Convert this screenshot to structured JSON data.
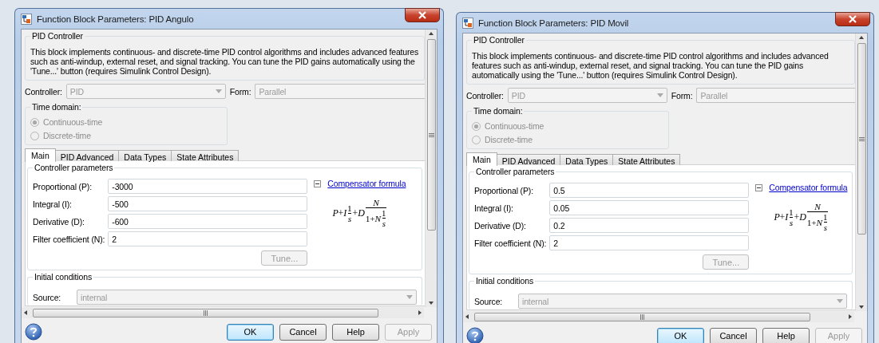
{
  "dialogs": [
    {
      "title": "Function Block Parameters: PID Angulo",
      "group_title": "PID Controller",
      "description": "This block implements continuous- and discrete-time PID control algorithms and includes advanced features such as anti-windup, external reset, and signal tracking. You can tune the PID gains automatically using the 'Tune...' button (requires Simulink Control Design).",
      "controller": {
        "label": "Controller:",
        "value": "PID",
        "disabled": true
      },
      "form": {
        "label": "Form:",
        "value": "Parallel",
        "disabled": true
      },
      "time_domain": {
        "title": "Time domain:",
        "options": [
          {
            "label": "Continuous-time",
            "selected": true,
            "disabled": true
          },
          {
            "label": "Discrete-time",
            "selected": false,
            "disabled": true
          }
        ]
      },
      "tabs": [
        {
          "label": "Main",
          "selected": true
        },
        {
          "label": "PID Advanced",
          "selected": false
        },
        {
          "label": "Data Types",
          "selected": false
        },
        {
          "label": "State Attributes",
          "selected": false
        }
      ],
      "parameters": {
        "title": "Controller parameters",
        "fields": [
          {
            "label": "Proportional (P):",
            "value": "-3000"
          },
          {
            "label": "Integral (I):",
            "value": "-500"
          },
          {
            "label": "Derivative (D):",
            "value": "-600"
          },
          {
            "label": "Filter coefficient (N):",
            "value": "2"
          }
        ],
        "link": "Compensator formula",
        "expanded": true,
        "formula": [
          {
            "kind": "var",
            "text": "P"
          },
          {
            "kind": "op",
            "text": "+"
          },
          {
            "kind": "var",
            "text": "I"
          },
          {
            "kind": "fraction",
            "num": [
              {
                "kind": "op",
                "text": "1"
              }
            ],
            "den": [
              {
                "kind": "var",
                "text": "s"
              }
            ]
          },
          {
            "kind": "op",
            "text": "+"
          },
          {
            "kind": "var",
            "text": "D"
          },
          {
            "kind": "fraction",
            "num": [
              {
                "kind": "var",
                "text": "N"
              }
            ],
            "den": [
              {
                "kind": "op",
                "text": "1+"
              },
              {
                "kind": "var",
                "text": "N"
              },
              {
                "kind": "fraction",
                "num": [
                  {
                    "kind": "op",
                    "text": "1"
                  }
                ],
                "den": [
                  {
                    "kind": "var",
                    "text": "s"
                  }
                ]
              }
            ]
          }
        ],
        "tune": {
          "label": "Tune...",
          "disabled": true
        }
      },
      "initial_conditions": {
        "title": "Initial conditions",
        "source": {
          "label": "Source:",
          "value": "internal",
          "disabled": true
        }
      },
      "buttons": [
        {
          "label": "OK",
          "default": true,
          "disabled": false
        },
        {
          "label": "Cancel",
          "default": false,
          "disabled": false
        },
        {
          "label": "Help",
          "default": false,
          "disabled": false
        },
        {
          "label": "Apply",
          "default": false,
          "disabled": true
        }
      ]
    },
    {
      "title": "Function Block Parameters: PID Movil",
      "group_title": "PID Controller",
      "description": "This block implements continuous- and discrete-time PID control algorithms and includes advanced features such as anti-windup, external reset, and signal tracking. You can tune the PID gains automatically using the 'Tune...' button (requires Simulink Control Design).",
      "controller": {
        "label": "Controller:",
        "value": "PID",
        "disabled": true
      },
      "form": {
        "label": "Form:",
        "value": "Parallel",
        "disabled": true
      },
      "time_domain": {
        "title": "Time domain:",
        "options": [
          {
            "label": "Continuous-time",
            "selected": true,
            "disabled": true
          },
          {
            "label": "Discrete-time",
            "selected": false,
            "disabled": true
          }
        ]
      },
      "tabs": [
        {
          "label": "Main",
          "selected": true
        },
        {
          "label": "PID Advanced",
          "selected": false
        },
        {
          "label": "Data Types",
          "selected": false
        },
        {
          "label": "State Attributes",
          "selected": false
        }
      ],
      "parameters": {
        "title": "Controller parameters",
        "fields": [
          {
            "label": "Proportional (P):",
            "value": "0.5"
          },
          {
            "label": "Integral (I):",
            "value": "0.05"
          },
          {
            "label": "Derivative (D):",
            "value": "0.2"
          },
          {
            "label": "Filter coefficient (N):",
            "value": "2"
          }
        ],
        "link": "Compensator formula",
        "expanded": true,
        "formula": [
          {
            "kind": "var",
            "text": "P"
          },
          {
            "kind": "op",
            "text": "+"
          },
          {
            "kind": "var",
            "text": "I"
          },
          {
            "kind": "fraction",
            "num": [
              {
                "kind": "op",
                "text": "1"
              }
            ],
            "den": [
              {
                "kind": "var",
                "text": "s"
              }
            ]
          },
          {
            "kind": "op",
            "text": "+"
          },
          {
            "kind": "var",
            "text": "D"
          },
          {
            "kind": "fraction",
            "num": [
              {
                "kind": "var",
                "text": "N"
              }
            ],
            "den": [
              {
                "kind": "op",
                "text": "1+"
              },
              {
                "kind": "var",
                "text": "N"
              },
              {
                "kind": "fraction",
                "num": [
                  {
                    "kind": "op",
                    "text": "1"
                  }
                ],
                "den": [
                  {
                    "kind": "var",
                    "text": "s"
                  }
                ]
              }
            ]
          }
        ],
        "tune": {
          "label": "Tune...",
          "disabled": true
        }
      },
      "initial_conditions": {
        "title": "Initial conditions",
        "source": {
          "label": "Source:",
          "value": "internal",
          "disabled": true
        }
      },
      "buttons": [
        {
          "label": "OK",
          "default": true,
          "disabled": false
        },
        {
          "label": "Cancel",
          "default": false,
          "disabled": false
        },
        {
          "label": "Help",
          "default": false,
          "disabled": false
        },
        {
          "label": "Apply",
          "default": false,
          "disabled": true
        }
      ]
    }
  ]
}
